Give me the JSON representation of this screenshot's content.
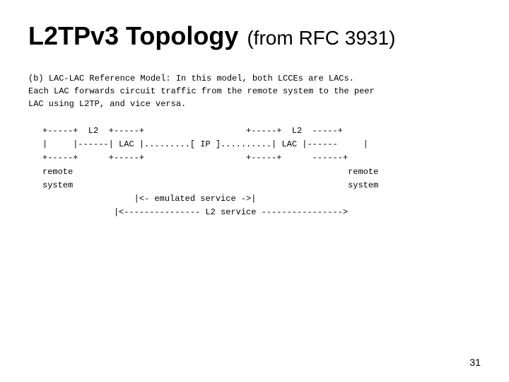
{
  "title": {
    "main": "L2TPv3 Topology",
    "subtitle": "(from RFC 3931)"
  },
  "description": "(b) LAC-LAC Reference Model: In this model, both LCCEs are LACs.\nEach LAC forwards circuit traffic from the remote system to the peer\nLAC using L2TP, and vice versa.",
  "diagram": "+-----+  L2  +-----+                    +-----+  L2  -----+\n|     |------| LAC |.........[ IP ]..........| LAC |------     |\n+-----+      +-----+                    +-----+      ------+\nremote                                                      remote\nsystem                                                      system\n                  |<- emulated service ->|\n              |<--------------- L2 service ---------------->",
  "page_number": "31"
}
